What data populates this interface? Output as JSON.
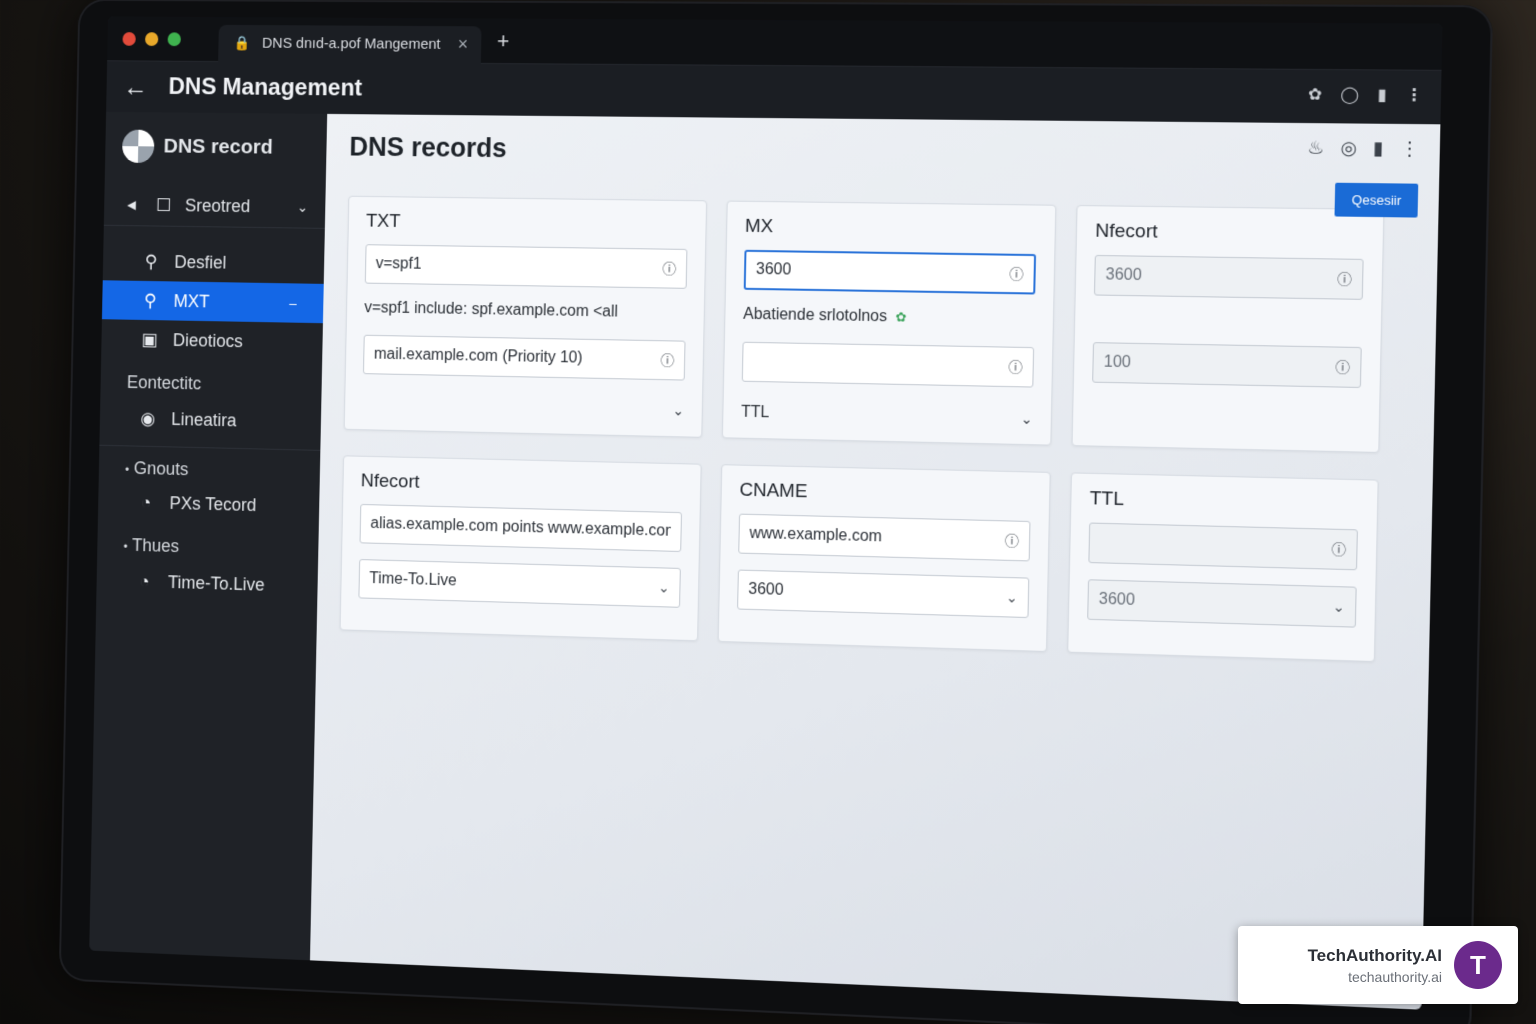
{
  "window": {
    "tab_title": "DNS dnıd-a.pof Mangement",
    "tab_close": "×",
    "new_tab": "+",
    "traffic_colors": [
      "#e24b3b",
      "#e8a82a",
      "#3fb34f"
    ]
  },
  "appbar": {
    "back": "←",
    "title": "DNS Management"
  },
  "sidebar": {
    "brand": "DNS record",
    "selector": {
      "label": "Sreotred"
    },
    "items": [
      {
        "label": "Desfiel",
        "icon": "search-icon"
      },
      {
        "label": "MXT",
        "icon": "search-icon",
        "active": true
      },
      {
        "label": "Dieotiocs",
        "icon": "folder-icon"
      }
    ],
    "section_1": {
      "title": "Eontectitc",
      "items": [
        {
          "label": "Lineatira",
          "icon": "camera-icon"
        }
      ]
    },
    "group_1": {
      "title": "Gnouts",
      "items": [
        {
          "label": "PXs Tecord",
          "icon": "globe-icon"
        }
      ]
    },
    "group_2": {
      "title": "Thues",
      "items": [
        {
          "label": "Time-To.Live",
          "icon": "globe-icon"
        }
      ]
    }
  },
  "main": {
    "title": "DNS records",
    "primary_button": "Qesesiir",
    "cards": {
      "txt": {
        "title": "TXT",
        "field_1": "v=spf1",
        "line": "v=spf1 include: spf.example.com <all",
        "field_2": "mail.example.com (Priority 10)"
      },
      "mx": {
        "title": "MX",
        "field_1": "3600",
        "line": "Abatiende srlotolnos",
        "field_2": "",
        "footer": "TTL"
      },
      "nrecord_1": {
        "title": "Nfecort",
        "field_1": "3600",
        "field_2": "100"
      },
      "nrecord_2": {
        "title": "Nfecort",
        "field_1": "alias.example.com points www.example.com",
        "select": "Time-To.Live"
      },
      "cname": {
        "title": "CNAME",
        "field_1": "www.example.com",
        "select": "3600"
      },
      "ttl": {
        "title": "TTL",
        "field_1": "",
        "select": "3600"
      }
    }
  },
  "watermark": {
    "title": "TechAuthority.AI",
    "subtitle": "techauthority.ai",
    "logo_letter": "T"
  }
}
